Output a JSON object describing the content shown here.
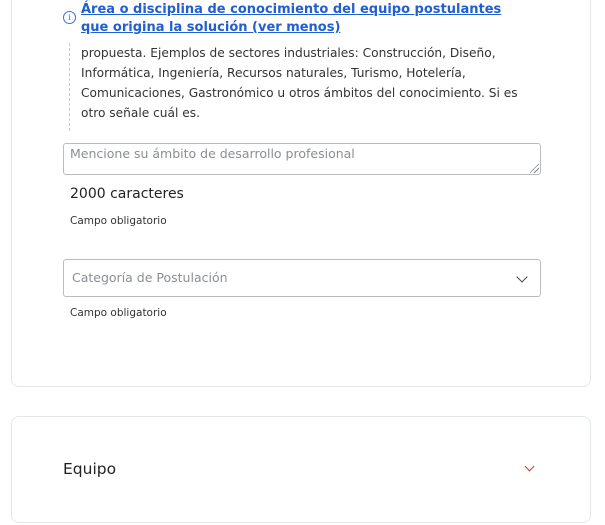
{
  "question": {
    "title": "Área o disciplina de conocimiento del equipo postulantes que origina la solución (ver menos)",
    "description": "propuesta. Ejemplos de sectores industriales: Construcción, Diseño, Informática, Ingeniería, Recursos naturales, Turismo, Hotelería, Comunicaciones, Gastronómico u otros ámbitos del conocimiento. Si es otro señale cuál es.",
    "info_icon": "info-icon"
  },
  "textarea": {
    "placeholder": "Mencione su ámbito de desarrollo profesional",
    "char_limit": "2000 caracteres",
    "required_label": "Campo obligatorio"
  },
  "category_select": {
    "placeholder": "Categoría de Postulación",
    "required_label": "Campo obligatorio",
    "icon": "chevron-down-icon"
  },
  "equipo_section": {
    "title": "Equipo",
    "icon": "chevron-down-icon",
    "accent_color": "#d0322b"
  },
  "colors": {
    "link": "#1f5fd1",
    "border": "#b9bdc2"
  }
}
